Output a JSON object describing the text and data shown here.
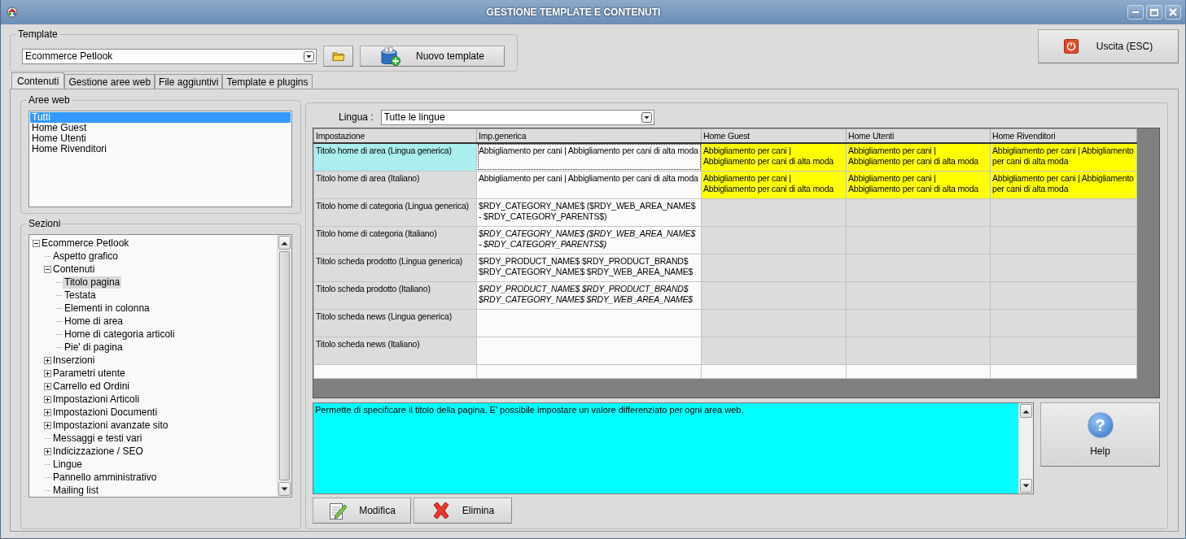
{
  "window": {
    "title": "GESTIONE TEMPLATE E CONTENUTI"
  },
  "template": {
    "label": "Template",
    "value": "Ecommerce Petlook",
    "new_button": "Nuovo template"
  },
  "exit_button": "Uscita (ESC)",
  "tabs": [
    {
      "label": "Contenuti",
      "selected": true
    },
    {
      "label": "Gestione aree web",
      "selected": false
    },
    {
      "label": "File aggiuntivi",
      "selected": false
    },
    {
      "label": "Template e plugins",
      "selected": false
    }
  ],
  "web_areas": {
    "label": "Aree web",
    "items": [
      {
        "label": "Tutti",
        "selected": true
      },
      {
        "label": "Home Guest",
        "selected": false
      },
      {
        "label": "Home Utenti",
        "selected": false
      },
      {
        "label": "Home Rivenditori",
        "selected": false
      }
    ]
  },
  "sections": {
    "label": "Sezioni",
    "tree": [
      {
        "label": "Ecommerce Petlook",
        "selected": false,
        "expanded": true,
        "children": [
          {
            "label": "Aspetto grafico",
            "selected": false
          },
          {
            "label": "Contenuti",
            "selected": false,
            "expanded": true,
            "children": [
              {
                "label": "Titolo pagina",
                "selected": true
              },
              {
                "label": "Testata",
                "selected": false
              },
              {
                "label": "Elementi in colonna",
                "selected": false
              },
              {
                "label": "Home di area",
                "selected": false
              },
              {
                "label": "Home di categoria articoli",
                "selected": false
              },
              {
                "label": "Pie' di pagina",
                "selected": false
              }
            ]
          },
          {
            "label": "Inserzioni",
            "selected": false,
            "expanded": false
          },
          {
            "label": "Parametri utente",
            "selected": false,
            "expanded": false
          },
          {
            "label": "Carrello ed Ordini",
            "selected": false,
            "expanded": false
          },
          {
            "label": "Impostazioni Articoli",
            "selected": false,
            "expanded": false
          },
          {
            "label": "Impostazioni Documenti",
            "selected": false,
            "expanded": false
          },
          {
            "label": "Impostazioni avanzate sito",
            "selected": false,
            "expanded": false
          },
          {
            "label": "Messaggi e testi vari",
            "selected": false
          },
          {
            "label": "Indicizzazione / SEO",
            "selected": false,
            "expanded": false
          },
          {
            "label": "Lingue",
            "selected": false
          },
          {
            "label": "Pannello amministrativo",
            "selected": false
          },
          {
            "label": "Mailing list",
            "selected": false
          }
        ]
      }
    ]
  },
  "language": {
    "label": "Lingua :",
    "value": "Tutte le lingue"
  },
  "table": {
    "columns": [
      "Impostazione",
      "Imp.generica",
      "Home Guest",
      "Home Utenti",
      "Home Rivenditori"
    ],
    "rows": [
      {
        "setting": "Titolo home di area (Lingua generica)",
        "selected": true,
        "generic": {
          "text": "Abbigliamento per cani | Abbigliamento per cani di alta moda",
          "inherited": false
        },
        "areas": [
          {
            "text": "Abbigliamento per cani | Abbigliamento per cani di alta moda",
            "custom": true
          },
          {
            "text": "Abbigliamento per cani | Abbigliamento per cani di alta moda",
            "custom": true
          },
          {
            "text": "Abbigliamento per cani | Abbigliamento per cani di alta moda",
            "custom": true
          }
        ]
      },
      {
        "setting": "Titolo home di area (Italiano)",
        "selected": false,
        "generic": {
          "text": "Abbigliamento per cani | Abbigliamento per cani di alta moda",
          "inherited": false
        },
        "areas": [
          {
            "text": "Abbigliamento per cani | Abbigliamento per cani di alta moda",
            "custom": true
          },
          {
            "text": "Abbigliamento per cani | Abbigliamento per cani di alta moda",
            "custom": true
          },
          {
            "text": "Abbigliamento per cani | Abbigliamento per cani di alta moda",
            "custom": true
          }
        ]
      },
      {
        "setting": "Titolo home di categoria (Lingua generica)",
        "selected": false,
        "generic": {
          "text": "$RDY_CATEGORY_NAME$ ($RDY_WEB_AREA_NAME$ - $RDY_CATEGORY_PARENTS$)",
          "inherited": false
        },
        "areas": [
          {
            "custom": false
          },
          {
            "custom": false
          },
          {
            "custom": false
          }
        ]
      },
      {
        "setting": "Titolo home di categoria (Italiano)",
        "selected": false,
        "generic": {
          "text": "$RDY_CATEGORY_NAME$ ($RDY_WEB_AREA_NAME$ - $RDY_CATEGORY_PARENTS$)",
          "inherited": true
        },
        "areas": [
          {
            "custom": false
          },
          {
            "custom": false
          },
          {
            "custom": false
          }
        ]
      },
      {
        "setting": "Titolo scheda prodotto (Lingua generica)",
        "selected": false,
        "generic": {
          "text": "$RDY_PRODUCT_NAME$ $RDY_PRODUCT_BRAND$ $RDY_CATEGORY_NAME$ $RDY_WEB_AREA_NAME$",
          "inherited": false
        },
        "areas": [
          {
            "custom": false
          },
          {
            "custom": false
          },
          {
            "custom": false
          }
        ]
      },
      {
        "setting": "Titolo scheda prodotto (Italiano)",
        "selected": false,
        "generic": {
          "text": "$RDY_PRODUCT_NAME$ $RDY_PRODUCT_BRAND$ $RDY_CATEGORY_NAME$ $RDY_WEB_AREA_NAME$",
          "inherited": true
        },
        "areas": [
          {
            "custom": false
          },
          {
            "custom": false
          },
          {
            "custom": false
          }
        ]
      },
      {
        "setting": "Titolo scheda news (Lingua generica)",
        "selected": false,
        "generic": {
          "inherited": false
        },
        "areas": [
          {
            "custom": false
          },
          {
            "custom": false
          },
          {
            "custom": false
          }
        ]
      },
      {
        "setting": "Titolo scheda news (Italiano)",
        "selected": false,
        "generic": {
          "inherited": false
        },
        "areas": [
          {
            "custom": false
          },
          {
            "custom": false
          },
          {
            "custom": false
          }
        ]
      }
    ]
  },
  "description": "Permette di specificare il titolo della pagina. E' possibile impostare un valore differenziato per ogni area web.",
  "help": {
    "glyph": "?",
    "label": "Help"
  },
  "actions": {
    "edit": "Modifica",
    "delete": "Elimina"
  }
}
